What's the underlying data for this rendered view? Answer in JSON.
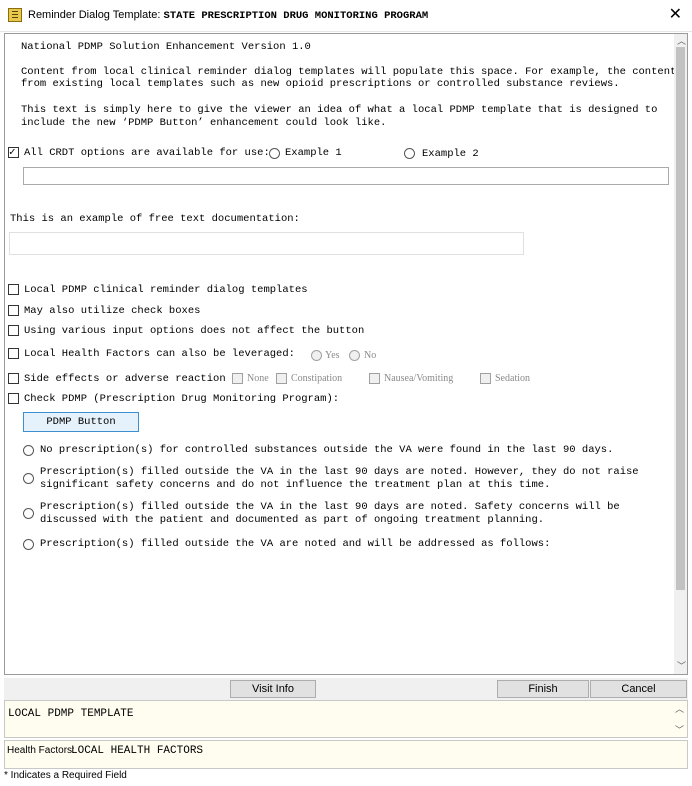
{
  "window": {
    "title_prefix": "Reminder Dialog Template:",
    "title_name": "STATE PRESCRIPTION DRUG MONITORING PROGRAM",
    "close_glyph": "✕"
  },
  "intro": {
    "version": "National PDMP Solution Enhancement Version 1.0",
    "para1_line1": "Content from local clinical reminder dialog templates will populate this space. For example, the content",
    "para1_line2": "from existing local templates such as new opioid prescriptions or controlled substance reviews.",
    "para2_line1": "This text is simply here to give the viewer an idea of what a local PDMP template that is designed to",
    "para2_line2": "include the new ‘PDMP Button’ enhancement could look like."
  },
  "crdt": {
    "label": "All CRDT options are available for use:",
    "checked": true,
    "option1": "Example 1",
    "option2": "Example 2",
    "input_value": ""
  },
  "free_text": {
    "label": "This is an example of free text documentation:",
    "value": ""
  },
  "checkboxes": [
    {
      "label": "Local PDMP clinical reminder dialog templates"
    },
    {
      "label": "May also utilize check boxes"
    },
    {
      "label": "Using various input options does not affect the button"
    }
  ],
  "health_factors_row": {
    "label": "Local Health Factors can also be leveraged:",
    "yes": "Yes",
    "no": "No"
  },
  "side_effects_row": {
    "label": "Side effects or adverse reaction :",
    "options": [
      "None",
      "Constipation",
      "Nausea/Vomiting",
      "Sedation"
    ]
  },
  "check_pdmp": {
    "label": "Check PDMP (Prescription Drug Monitoring Program):",
    "button": "PDMP Button"
  },
  "pdmp_options": [
    {
      "line1": "No prescription(s) for controlled substances outside the VA were found in the last 90 days.",
      "line2": ""
    },
    {
      "line1": "Prescription(s) filled outside the VA in the last 90 days are noted. However, they do not raise",
      "line2": "significant safety concerns and do not influence the treatment plan at this time."
    },
    {
      "line1": "Prescription(s) filled outside the VA in the last 90 days are noted. Safety concerns will be",
      "line2": "discussed with the patient and documented as part of ongoing treatment planning."
    },
    {
      "line1": "Prescription(s) filled outside the VA are noted and will be addressed as follows:",
      "line2": ""
    }
  ],
  "buttons": {
    "visit_info": "Visit Info",
    "finish": "Finish",
    "cancel": "Cancel"
  },
  "preview": {
    "text": "LOCAL PDMP TEMPLATE"
  },
  "health_factors": {
    "label": "Health Factors:",
    "value": "LOCAL HEALTH FACTORS"
  },
  "footer": {
    "note": "* Indicates a Required Field"
  }
}
